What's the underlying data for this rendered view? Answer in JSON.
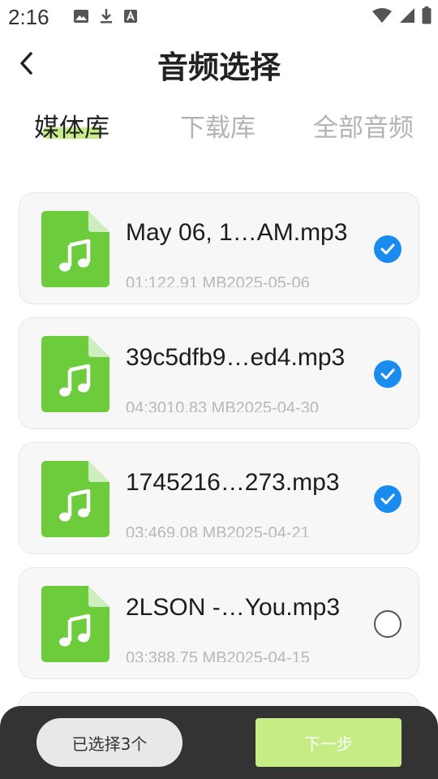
{
  "status_bar": {
    "time": "2:16",
    "left_icons": [
      "image-icon",
      "download-icon",
      "text-a-icon"
    ],
    "right_icons": [
      "wifi-icon",
      "signal-icon",
      "battery-icon"
    ]
  },
  "header": {
    "title": "音频选择",
    "back_icon": "chevron-left-icon"
  },
  "tabs": [
    {
      "label": "媒体库",
      "active": true
    },
    {
      "label": "下载库",
      "active": false
    },
    {
      "label": "全部音频",
      "active": false
    }
  ],
  "files": [
    {
      "name": "May 06, 1…AM.mp3",
      "meta": "01:122.91 MB2025-05-06",
      "selected": true
    },
    {
      "name": "39c5dfb9…ed4.mp3",
      "meta": "04:3010.83 MB2025-04-30",
      "selected": true
    },
    {
      "name": "1745216…273.mp3",
      "meta": "03:469.08 MB2025-04-21",
      "selected": true
    },
    {
      "name": "2LSON -…You.mp3",
      "meta": "03:388.75 MB2025-04-15",
      "selected": false
    }
  ],
  "bottom_bar": {
    "selected_label": "已选择3个",
    "next_label": "下一步"
  },
  "colors": {
    "file_icon": "#6dcc3c",
    "check_on": "#1a8cf0",
    "tab_underline": "#c7ec8a",
    "next_button": "#c6ec86",
    "bottom_bar": "#333333"
  }
}
